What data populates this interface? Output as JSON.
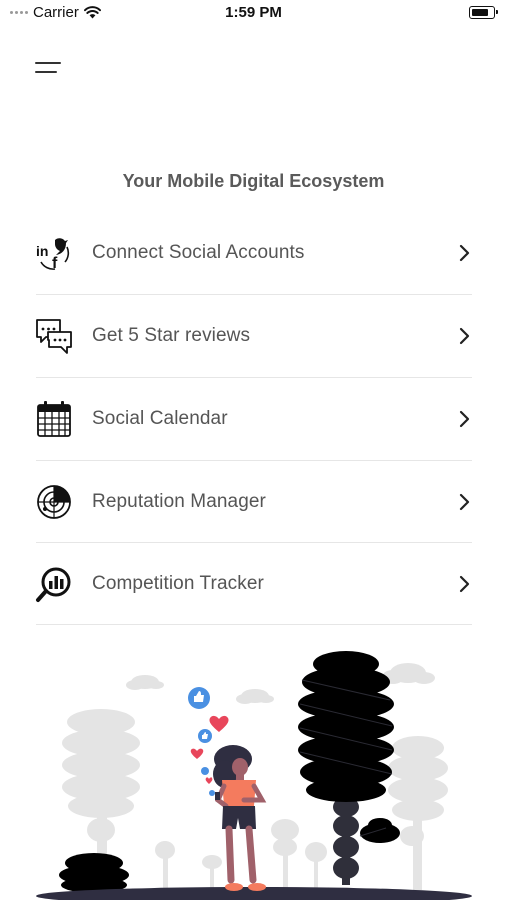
{
  "status_bar": {
    "carrier": "Carrier",
    "time": "1:59 PM"
  },
  "header": {
    "title": "Your Mobile Digital Ecosystem"
  },
  "menu": {
    "items": [
      {
        "label": "Connect Social Accounts",
        "icon": "social-accounts-icon"
      },
      {
        "label": "Get 5 Star reviews",
        "icon": "chat-bubbles-icon"
      },
      {
        "label": "Social Calendar",
        "icon": "calendar-icon"
      },
      {
        "label": "Reputation Manager",
        "icon": "radar-icon"
      },
      {
        "label": "Competition Tracker",
        "icon": "analytics-search-icon"
      }
    ]
  },
  "colors": {
    "text": "#555555",
    "title": "#5a5a5a",
    "divider": "#e6e6e6",
    "accent_shirt": "#f47b5e",
    "heart": "#e8465b",
    "like": "#4a90e2"
  }
}
